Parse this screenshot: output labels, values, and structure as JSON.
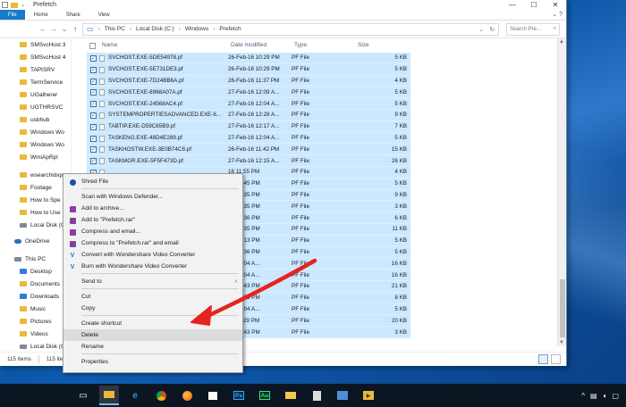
{
  "window": {
    "title": "Prefetch",
    "controls": {
      "minimize": "—",
      "maximize": "☐",
      "close": "✕"
    }
  },
  "ribbon": {
    "tabs": [
      "File",
      "Home",
      "Share",
      "View"
    ],
    "expand": "⌄ ?"
  },
  "address": {
    "back": "←",
    "forward": "→",
    "recent": "⌄",
    "up": "↑",
    "crumbs": [
      "This PC",
      "Local Disk (C:)",
      "Windows",
      "Prefetch"
    ],
    "sep": "›",
    "search_placeholder": "Search Pre...",
    "search_icon": "⌕"
  },
  "navpane": {
    "items": [
      {
        "label": "SMSvcHost 3",
        "icon": "folder",
        "pin": false
      },
      {
        "label": "SMSvcHost 4",
        "icon": "folder",
        "pin": false
      },
      {
        "label": "TAPISRV",
        "icon": "folder",
        "pin": false
      },
      {
        "label": "TermService",
        "icon": "folder",
        "pin": false
      },
      {
        "label": "UGatherer",
        "icon": "folder",
        "pin": false
      },
      {
        "label": "UGTHRSVC",
        "icon": "folder",
        "pin": false
      },
      {
        "label": "usbhub",
        "icon": "folder",
        "pin": false
      },
      {
        "label": "Windows Wo",
        "icon": "folder",
        "pin": false
      },
      {
        "label": "Windows Wo",
        "icon": "folder",
        "pin": false
      },
      {
        "label": "WmiApRpl",
        "icon": "folder",
        "pin": false
      },
      {
        "label": "wsearchidxp",
        "icon": "folder",
        "pin": false
      },
      {
        "label": "Footage",
        "icon": "folder",
        "pin": true
      },
      {
        "label": "How to Spe",
        "icon": "folder",
        "pin": true
      },
      {
        "label": "How to Use",
        "icon": "folder",
        "pin": true
      },
      {
        "label": "Local Disk (C",
        "icon": "drive",
        "pin": true
      },
      {
        "label": "OneDrive",
        "icon": "cloud",
        "pin": false
      },
      {
        "label": "This PC",
        "icon": "pc",
        "pin": false
      },
      {
        "label": "Desktop",
        "icon": "blue",
        "pin": false
      },
      {
        "label": "Documents",
        "icon": "folder",
        "pin": false
      },
      {
        "label": "Downloads",
        "icon": "blue",
        "pin": false
      },
      {
        "label": "Music",
        "icon": "folder",
        "pin": false
      },
      {
        "label": "Pictures",
        "icon": "folder",
        "pin": false
      },
      {
        "label": "Videos",
        "icon": "folder",
        "pin": false
      },
      {
        "label": "Local Disk (C",
        "icon": "drive",
        "pin": false
      }
    ]
  },
  "columns": {
    "name": "Name",
    "date": "Date modified",
    "type": "Type",
    "size": "Size"
  },
  "files": [
    {
      "name": "SVCHOST.EXE-5DE54978.pf",
      "date": "26-Feb-16 10:29 PM",
      "type": "PF File",
      "size": "5 KB"
    },
    {
      "name": "SVCHOST.EXE-5E731DE3.pf",
      "date": "26-Feb-16 10:29 PM",
      "type": "PF File",
      "size": "5 KB"
    },
    {
      "name": "SVCHOST.EXE-7D24BB6A.pf",
      "date": "26-Feb-16 11:37 PM",
      "type": "PF File",
      "size": "4 KB"
    },
    {
      "name": "SVCHOST.EXE-8968A07A.pf",
      "date": "27-Feb-16 12:09 A...",
      "type": "PF File",
      "size": "5 KB"
    },
    {
      "name": "SVCHOST.EXE-24568AC4.pf",
      "date": "27-Feb-16 12:04 A...",
      "type": "PF File",
      "size": "5 KB"
    },
    {
      "name": "SYSTEMPROPERTIESADVANCED.EXE-6...",
      "date": "27-Feb-16 12:28 A...",
      "type": "PF File",
      "size": "9 KB"
    },
    {
      "name": "TABTIP.EXE-D59C65B9.pf",
      "date": "27-Feb-16 12:17 A...",
      "type": "PF File",
      "size": "7 KB"
    },
    {
      "name": "TASKENG.EXE-48D4E289.pf",
      "date": "27-Feb-16 12:04 A...",
      "type": "PF File",
      "size": "5 KB"
    },
    {
      "name": "TASKHOSTW.EXE-3E0B74C8.pf",
      "date": "26-Feb-16 11:42 PM",
      "type": "PF File",
      "size": "15 KB"
    },
    {
      "name": "TASKMGR.EXE-5F5F473D.pf",
      "date": "27-Feb-16 12:15 A...",
      "type": "PF File",
      "size": "26 KB"
    },
    {
      "name": "",
      "date": "16 11:55 PM",
      "type": "PF File",
      "size": "4 KB"
    },
    {
      "name": "",
      "date": "16 10:45 PM",
      "type": "PF File",
      "size": "5 KB"
    },
    {
      "name": "",
      "date": "16 10:35 PM",
      "type": "PF File",
      "size": "9 KB"
    },
    {
      "name": "",
      "date": "16 10:35 PM",
      "type": "PF File",
      "size": "3 KB"
    },
    {
      "name": "",
      "date": "16 10:36 PM",
      "type": "PF File",
      "size": "6 KB"
    },
    {
      "name": "",
      "date": "16 10:35 PM",
      "type": "PF File",
      "size": "11 KB"
    },
    {
      "name": "",
      "date": "16 10:13 PM",
      "type": "PF File",
      "size": "5 KB"
    },
    {
      "name": "",
      "date": "16 10:36 PM",
      "type": "PF File",
      "size": "5 KB"
    },
    {
      "name": "",
      "date": "16 12:04 A...",
      "type": "PF File",
      "size": "16 KB"
    },
    {
      "name": "",
      "date": "16 12:04 A...",
      "type": "PF File",
      "size": "16 KB"
    },
    {
      "name": "",
      "date": "16 10:43 PM",
      "type": "PF File",
      "size": "21 KB"
    },
    {
      "name": "",
      "date": "16 10:31 PM",
      "type": "PF File",
      "size": "8 KB"
    },
    {
      "name": "",
      "date": "16 12:04 A...",
      "type": "PF File",
      "size": "5 KB"
    },
    {
      "name": "",
      "date": "16 11:29 PM",
      "type": "PF File",
      "size": "20 KB"
    },
    {
      "name": "",
      "date": "16 10:43 PM",
      "type": "PF File",
      "size": "3 KB"
    }
  ],
  "status": {
    "items": "115 items",
    "selected": "115 items selected"
  },
  "context_menu": {
    "items": [
      {
        "label": "Shred File",
        "icon": "shred-icon",
        "sep_after": true
      },
      {
        "label": "Scan with Windows Defender...",
        "icon": "",
        "sep_after": false
      },
      {
        "label": "Add to archive...",
        "icon": "rar-icon",
        "sep_after": false
      },
      {
        "label": "Add to \"Prefetch.rar\"",
        "icon": "rar-icon",
        "sep_after": false
      },
      {
        "label": "Compress and email...",
        "icon": "rar-icon",
        "sep_after": false
      },
      {
        "label": "Compress to \"Prefetch.rar\" and email",
        "icon": "rar-icon",
        "sep_after": false
      },
      {
        "label": "Convert with Wondershare Video Converter",
        "icon": "v-icon",
        "sep_after": false
      },
      {
        "label": "Burn with Wondershare Video Converter",
        "icon": "v-icon",
        "sep_after": true
      },
      {
        "label": "Send to",
        "icon": "",
        "submenu": true,
        "sep_after": true
      },
      {
        "label": "Cut",
        "icon": "",
        "sep_after": false
      },
      {
        "label": "Copy",
        "icon": "",
        "sep_after": true
      },
      {
        "label": "Create shortcut",
        "icon": "",
        "sep_after": false
      },
      {
        "label": "Delete",
        "icon": "",
        "highlight": true,
        "sep_after": false
      },
      {
        "label": "Rename",
        "icon": "",
        "sep_after": true
      },
      {
        "label": "Properties",
        "icon": "",
        "sep_after": false
      }
    ]
  },
  "taskbar": {
    "apps": [
      "task-view",
      "file-explorer",
      "edge",
      "chrome",
      "firefox",
      "store",
      "photoshop",
      "audition",
      "folder",
      "calculator",
      "photos",
      "media"
    ],
    "ps_label": "Ps",
    "au_label": "Au"
  },
  "colors": {
    "selection": "#cce8ff",
    "file_tab": "#1979ca",
    "arrow": "#e52420"
  }
}
